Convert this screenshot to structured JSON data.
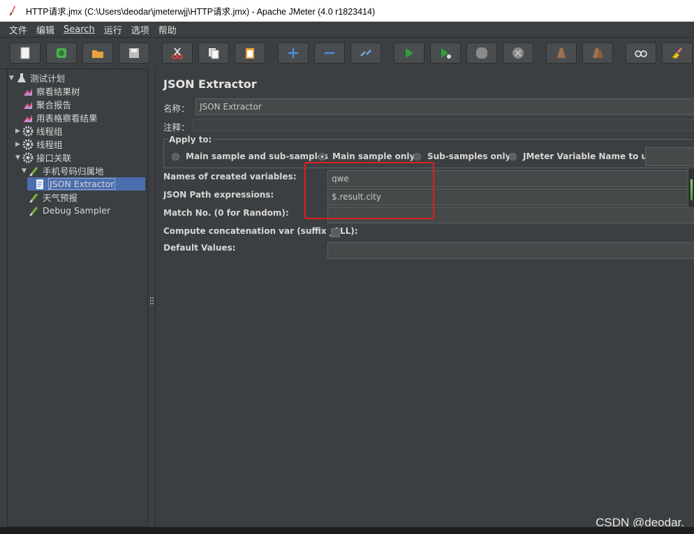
{
  "window": {
    "title": "HTTP请求.jmx (C:\\Users\\deodar\\jmeterwjj\\HTTP请求.jmx) - Apache JMeter (4.0 r1823414)"
  },
  "menu": [
    "文件",
    "编辑",
    "Search",
    "运行",
    "选项",
    "帮助"
  ],
  "toolbar": [
    {
      "name": "new-icon",
      "color": "#f0f0f0"
    },
    {
      "name": "templates-icon",
      "color": "#4caf50"
    },
    {
      "name": "open-icon",
      "color": "#e8a33c"
    },
    {
      "name": "save-icon",
      "color": "#cfcfcf"
    },
    {
      "name": "cut-icon",
      "color": "#e53935"
    },
    {
      "name": "copy-icon",
      "color": "#dddddd"
    },
    {
      "name": "paste-icon",
      "color": "#e8a33c"
    },
    {
      "name": "expand-icon",
      "color": "#4a90e2"
    },
    {
      "name": "collapse-icon",
      "color": "#4a90e2"
    },
    {
      "name": "toggle-icon",
      "color": "#6fa8dc"
    },
    {
      "name": "start-icon",
      "color": "#2e9e3a"
    },
    {
      "name": "start-no-pause-icon",
      "color": "#2e9e3a"
    },
    {
      "name": "stop-icon",
      "color": "#888888"
    },
    {
      "name": "shutdown-icon",
      "color": "#888888"
    },
    {
      "name": "clear-icon",
      "color": "#a0714f"
    },
    {
      "name": "clear-all-icon",
      "color": "#a0714f"
    },
    {
      "name": "search-icon",
      "color": "#dddddd"
    },
    {
      "name": "reset-search-icon",
      "color": "#f2c200"
    }
  ],
  "tree": [
    {
      "label": "测试计划",
      "icon": "test-plan-icon",
      "arrow": "▼",
      "indent": 0
    },
    {
      "label": "察看结果树",
      "icon": "listener-icon",
      "arrow": "",
      "indent": 1
    },
    {
      "label": "聚合报告",
      "icon": "listener-icon",
      "arrow": "",
      "indent": 1
    },
    {
      "label": "用表格察看结果",
      "icon": "listener-icon",
      "arrow": "",
      "indent": 1
    },
    {
      "label": "线程组",
      "icon": "gear-icon",
      "arrow": "▶",
      "indent": 1
    },
    {
      "label": "线程组",
      "icon": "gear-icon",
      "arrow": "▶",
      "indent": 1
    },
    {
      "label": "接口关联",
      "icon": "gear-icon",
      "arrow": "▼",
      "indent": 1
    },
    {
      "label": "手机号码归属地",
      "icon": "sampler-icon",
      "arrow": "▼",
      "indent": 2
    },
    {
      "label": "JSON Extractor",
      "icon": "extractor-icon",
      "arrow": "",
      "indent": 3,
      "selected": true
    },
    {
      "label": "天气预报",
      "icon": "sampler-icon",
      "arrow": "",
      "indent": 2
    },
    {
      "label": "Debug Sampler",
      "icon": "sampler-icon",
      "arrow": "",
      "indent": 2
    }
  ],
  "panel": {
    "title": "JSON Extractor",
    "name_label": "名称：",
    "name_value": "JSON Extractor",
    "comment_label": "注释：",
    "apply_to_label": "Apply to:",
    "apply_options": [
      "Main sample and sub-samples",
      "Main sample only",
      "Sub-samples only",
      "JMeter Variable Name to use"
    ],
    "apply_selected": "Main sample only",
    "fields": [
      {
        "label": "Names of created variables:",
        "value": "qwe"
      },
      {
        "label": "JSON Path expressions:",
        "value": "$.result.city"
      },
      {
        "label": "Match No. (0 for Random):",
        "value": ""
      },
      {
        "label": "Compute concatenation var (suffix _ALL):",
        "value": ""
      },
      {
        "label": "Default Values:",
        "value": ""
      }
    ]
  },
  "watermark": "CSDN @deodar.",
  "colors": {
    "highlight": "#e01f1f",
    "selection": "#4b6eaf",
    "background": "#3c3f41"
  }
}
